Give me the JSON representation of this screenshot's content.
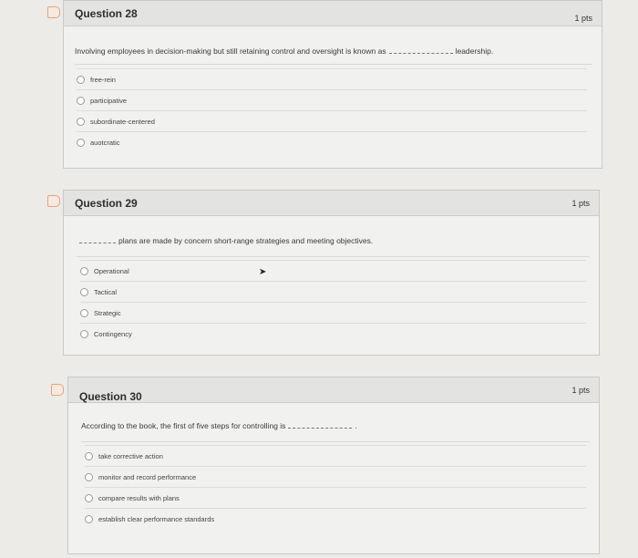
{
  "questions": [
    {
      "title": "Question 28",
      "points": "1 pts",
      "prompt_before": "Involving employees in decision-making but still retaining control and oversight is known as",
      "prompt_after": "leadership.",
      "options": [
        "free-rein",
        "participative",
        "subordinate-centered",
        "auotcratic"
      ]
    },
    {
      "title": "Question 29",
      "points": "1 pts",
      "prompt_before": "",
      "prompt_after": "plans are made by concern short-range strategies and meeting objectives.",
      "options": [
        "Operational",
        "Tactical",
        "Strategic",
        "Contingency"
      ]
    },
    {
      "title": "Question 30",
      "points": "1 pts",
      "prompt_before": "According to the book, the first of five steps for controlling is",
      "prompt_after": ".",
      "options": [
        "take corrective action",
        "monitor and record performance",
        "compare results with plans",
        "establish clear performance standards"
      ]
    }
  ],
  "colors": {
    "flag": "#e8a27a",
    "header_bg": "#e3e3e2",
    "card_bg": "#f1f1f0"
  },
  "icons": [
    "flag-icon",
    "radio-icon",
    "mouse-pointer-icon"
  ]
}
